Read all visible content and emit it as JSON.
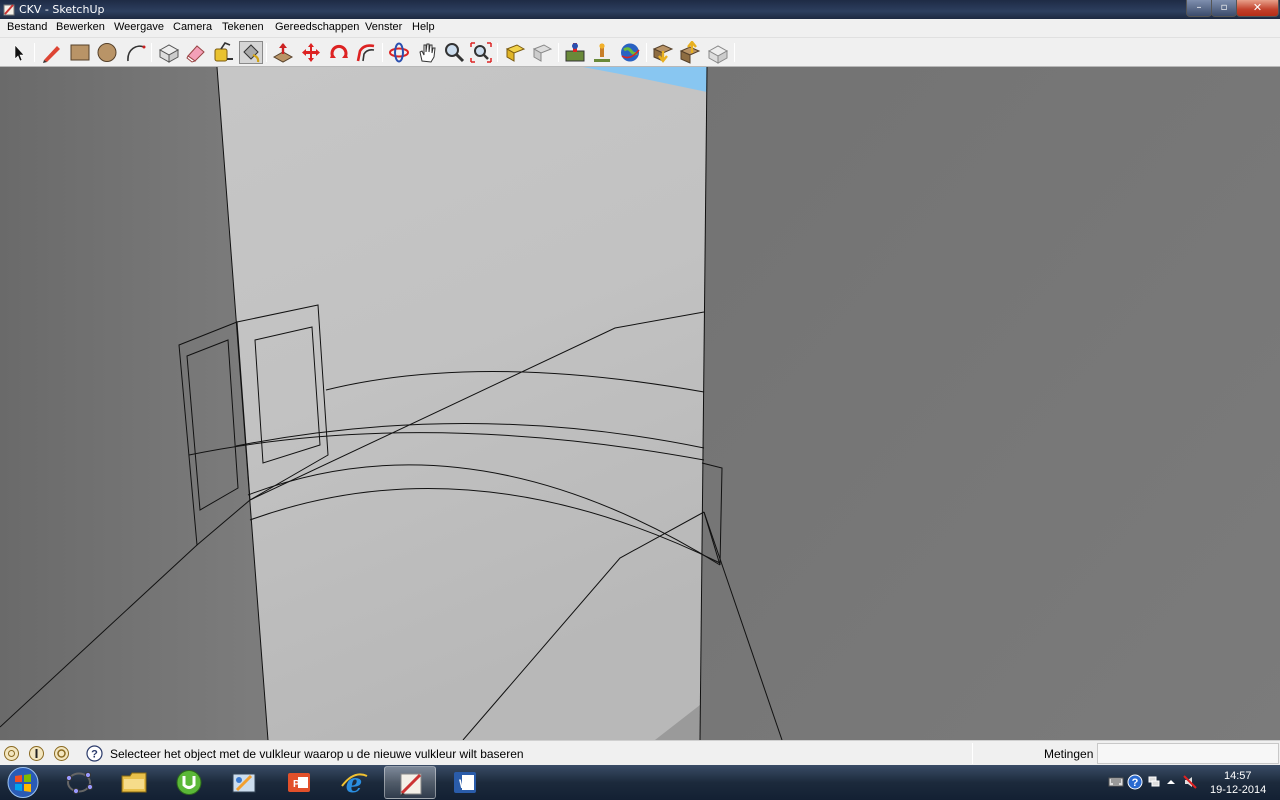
{
  "window": {
    "title": "CKV - SketchUp",
    "minimize": "–",
    "maximize": "▫",
    "close": "✕"
  },
  "menu": [
    "Bestand",
    "Bewerken",
    "Weergave",
    "Camera",
    "Tekenen",
    "Gereedschappen",
    "Venster",
    "Help"
  ],
  "toolbar": {
    "tools": [
      "select-tool",
      "pencil-tool",
      "rectangle-tool",
      "circle-tool",
      "arc-tool",
      "make-component-tool",
      "eraser-tool",
      "tape-measure-tool",
      "paint-bucket-tool",
      "push-pull-tool",
      "move-tool",
      "rotate-tool",
      "follow-me-tool",
      "orbit-tool",
      "pan-tool",
      "zoom-tool",
      "zoom-extents-tool",
      "previous-view-tool",
      "next-view-tool",
      "add-location-tool",
      "toggle-terrain-tool",
      "google-earth-tool",
      "get-models-tool",
      "share-model-tool",
      "extension-warehouse-tool"
    ]
  },
  "status": {
    "text": "Selecteer het object met de vulkleur waarop u de nieuwe vulkleur wilt baseren",
    "measurements_label": "Metingen",
    "measurements_value": ""
  },
  "taskbar": {
    "apps": [
      "windows-explorer-icon",
      "geogebra-icon",
      "folder-icon",
      "utorrent-icon",
      "paint-icon",
      "office-icon",
      "internet-explorer-icon",
      "sketchup-icon",
      "word-icon"
    ],
    "active_app": "sketchup-icon",
    "time": "14:57",
    "date": "19-12-2014"
  },
  "colors": {
    "viewport_background": "#777777",
    "face_light": "#c4c4c4",
    "sky": "#88c6f1"
  }
}
